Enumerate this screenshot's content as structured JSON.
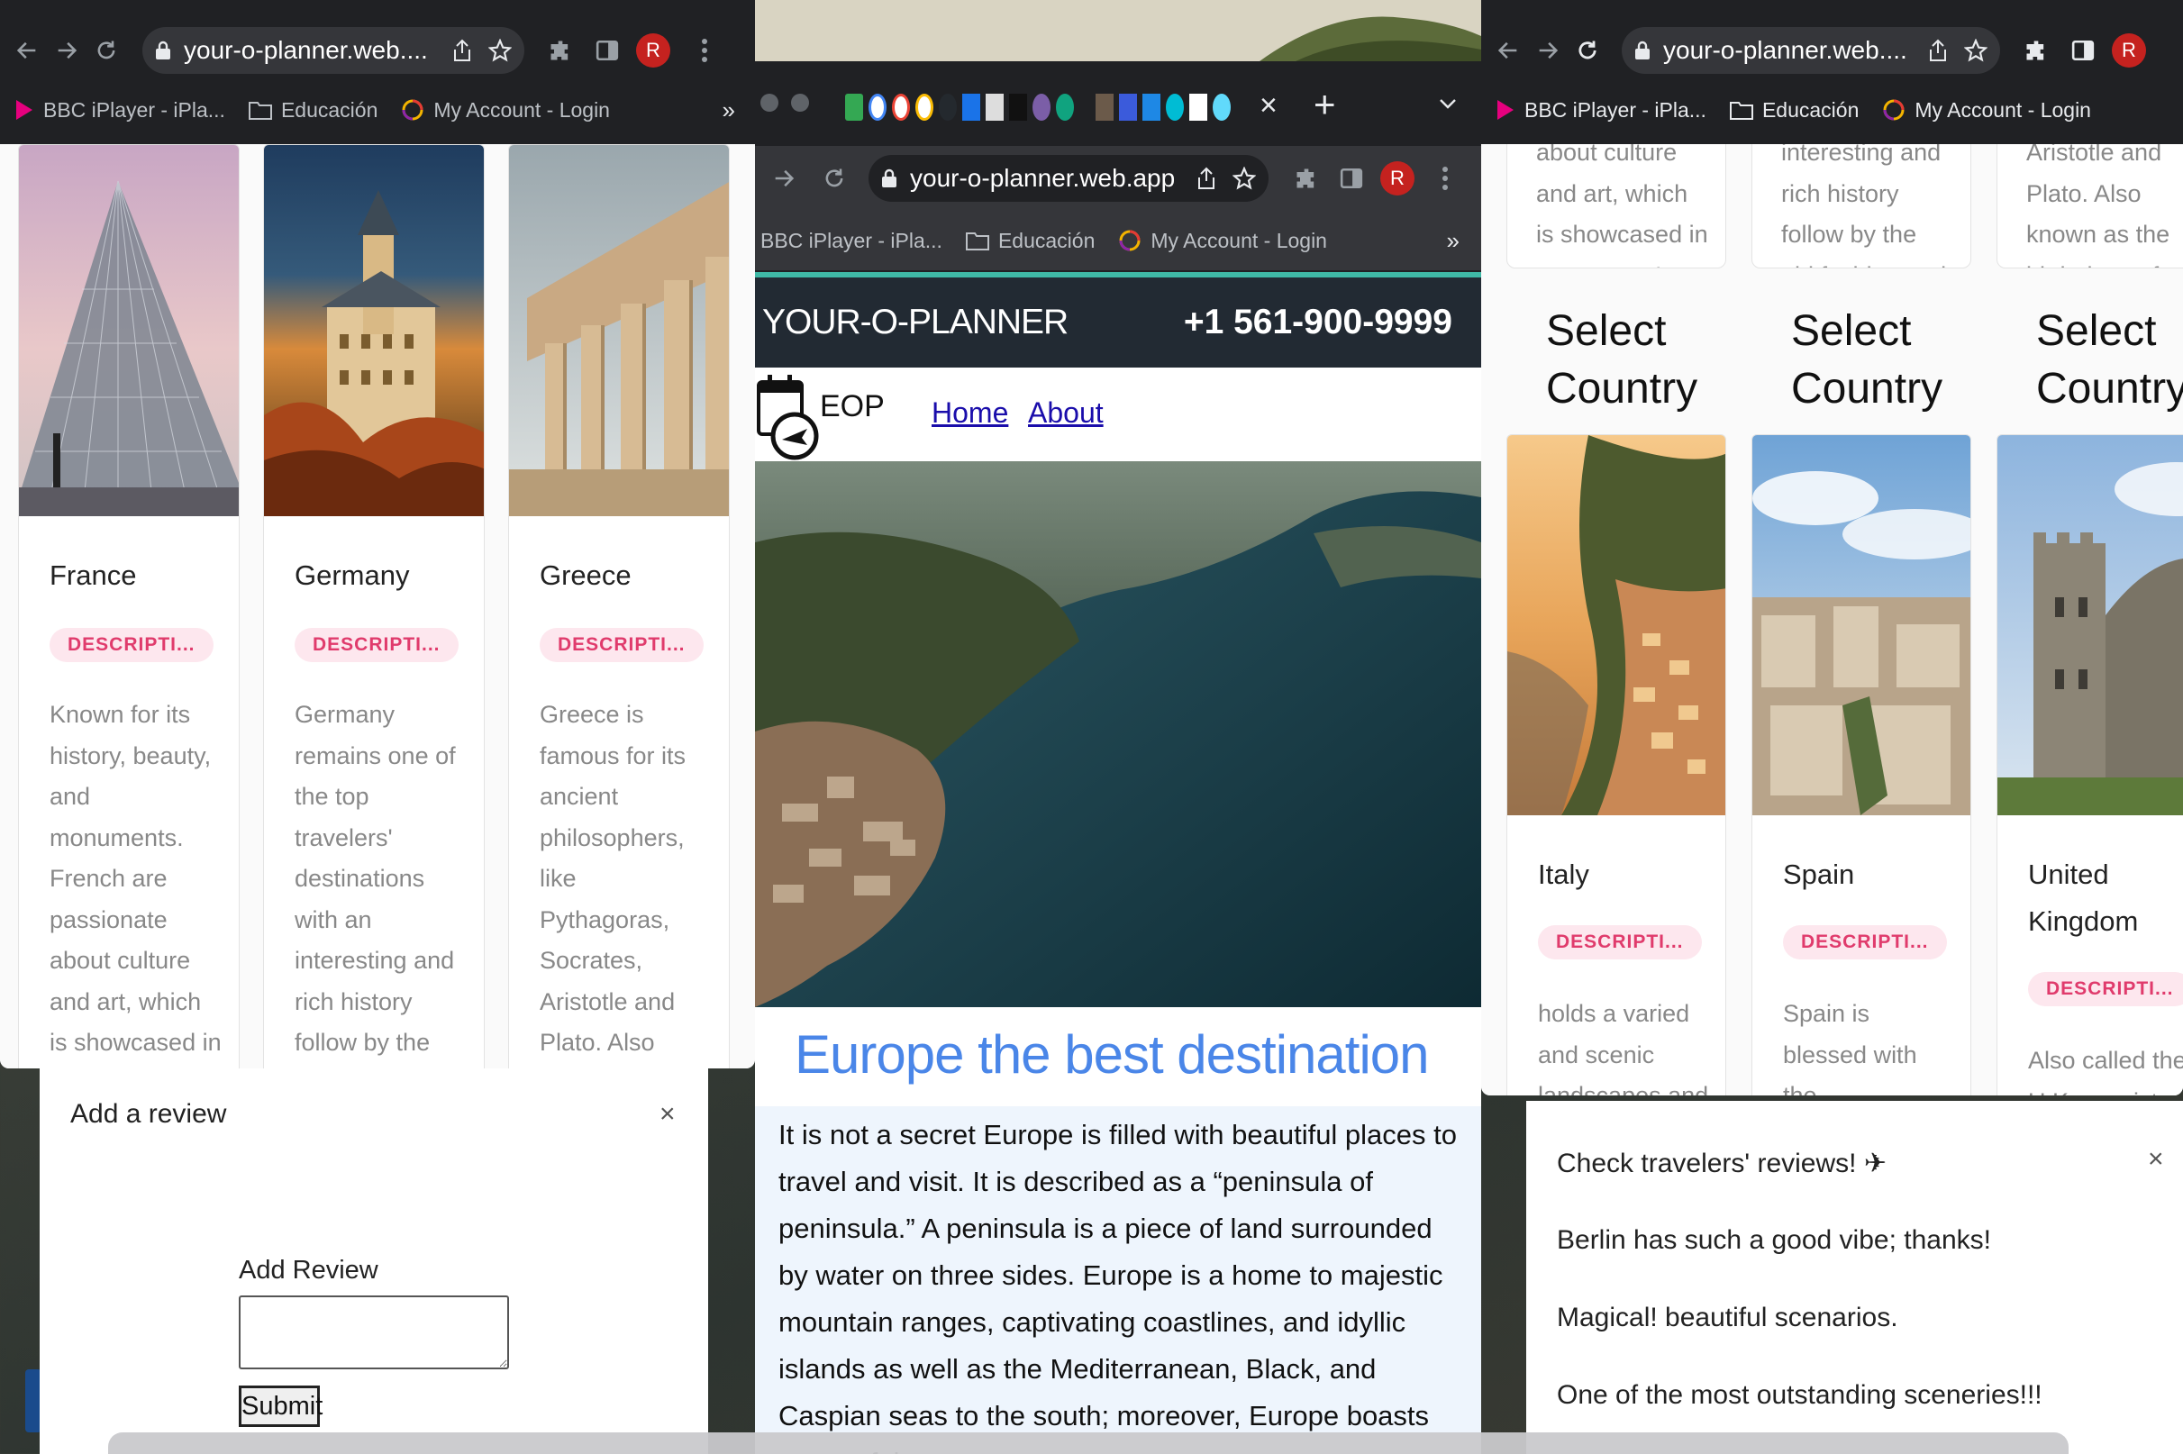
{
  "browser": {
    "url_short": "your-o-planner.web....",
    "url_full": "your-o-planner.web.app",
    "avatar_letter": "R",
    "bookmarks": {
      "bbc": "BBC iPlayer - iPla...",
      "educacion": "Educación",
      "account": "My Account - Login",
      "more": "»"
    },
    "tab_close": "×",
    "new_tab": "+"
  },
  "site": {
    "brand": "YOUR-O-PLANNER",
    "phone": "+1 561-900-9999",
    "logo_text": "EOP",
    "nav_home": "Home",
    "nav_about": "About",
    "headline": "Europe the best destination",
    "intro": "It is not a secret Europe is filled with beautiful places to travel and visit. It is described as a “peninsula of peninsula.” A peninsula is a piece of land surrounded by water on three sides. Europe is a home to majestic mountain ranges, captivating coastlines, and idyllic islands as well as the Mediterranean, Black, and Caspian seas to the south; moreover, Europe boasts some of the"
  },
  "left_cards": [
    {
      "name": "France",
      "chip": "DESCRIPTI...",
      "desc": "Known for its history, beauty, and monuments. French are passionate about culture and art, which is showcased in"
    },
    {
      "name": "Germany",
      "chip": "DESCRIPTI...",
      "desc": "Germany remains one of the top travelers' destinations with an interesting and rich history follow by the"
    },
    {
      "name": "Greece",
      "chip": "DESCRIPTI...",
      "desc": "Greece is famous for its ancient philosophers, like Pythagoras, Socrates, Aristotle and Plato. Also known as the"
    }
  ],
  "right_top_snippets": [
    "about culture and art, which is showcased in museums. It",
    "interesting and rich history follow by the old fashion and",
    "Aristotle and Plato. Also known as the birthplace of"
  ],
  "right_section_heading": "Select Country",
  "right_cards": [
    {
      "name": "Italy",
      "chip": "DESCRIPTI...",
      "desc": "holds a varied and scenic landscapes and"
    },
    {
      "name": "Spain",
      "chip": "DESCRIPTI...",
      "desc": "Spain is blessed with the"
    },
    {
      "name": "United Kingdom",
      "chip": "DESCRIPTI...",
      "desc": "Also called the U.K. consist of"
    }
  ],
  "review_modal": {
    "title": "Add a review",
    "close": "×",
    "field_label": "Add Review",
    "textarea_value": "",
    "submit": "Submit"
  },
  "reviews_popup": {
    "title": "Check travelers' reviews! ✈",
    "close": "×",
    "items": [
      "Berlin has such a good vibe; thanks!",
      "Magical! beautiful scenarios.",
      "One of the most outstanding sceneries!!!"
    ]
  },
  "colors": {
    "chrome_bg": "#202124",
    "omnibox_bg": "#35363a",
    "chip_bg": "#fde7ee",
    "chip_text": "#e03b6c",
    "headline_blue": "#4a86e8",
    "site_header_bg": "#222a33",
    "accent_teal": "#3fb9a6"
  }
}
